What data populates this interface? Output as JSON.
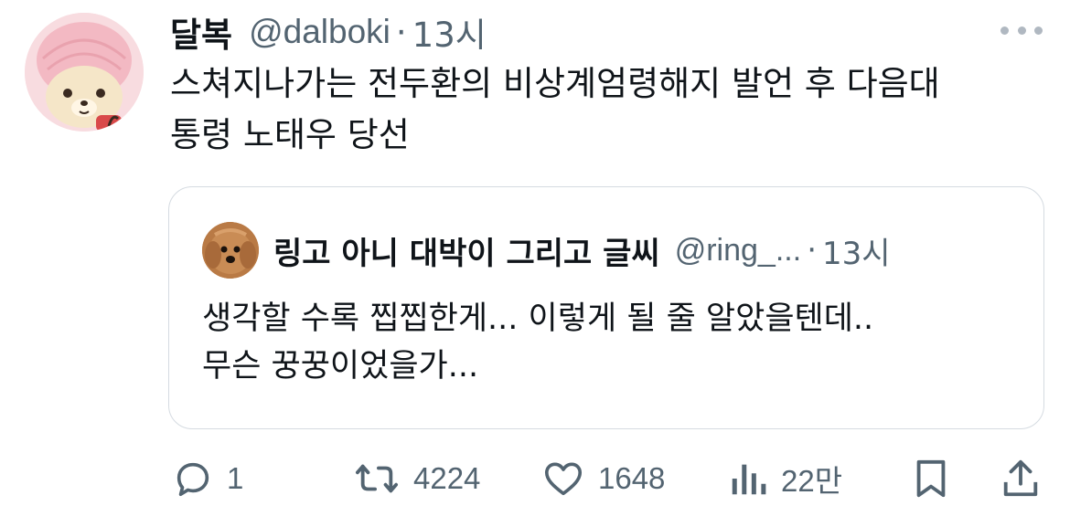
{
  "tweet": {
    "author_name": "달복",
    "author_handle": "@dalboki",
    "separator": "·",
    "time": "13시",
    "text_line1": "스쳐지나가는 전두환의 비상계엄령해지 발언 후 다음대",
    "text_line2": "통령 노태우 당선"
  },
  "quote": {
    "author_name": "링고 아니 대박이 그리고 글씨",
    "author_handle": "@ring_...",
    "separator": "·",
    "time": "13시",
    "text_line1": "생각할 수록 찝찝한게... 이렇게 될 줄 알았을텐데..",
    "text_line2": "무슨 꿍꿍이었을가..."
  },
  "actions": {
    "reply_count": "1",
    "retweet_count": "4224",
    "like_count": "1648",
    "views_count": "22만"
  },
  "icons": {
    "more": "more-horizontal-icon",
    "reply": "reply-icon",
    "retweet": "retweet-icon",
    "like": "heart-icon",
    "views": "views-icon",
    "bookmark": "bookmark-icon",
    "share": "share-icon"
  },
  "colors": {
    "text_primary": "#0f1419",
    "text_secondary": "#536471",
    "border": "#d5dbe1"
  }
}
